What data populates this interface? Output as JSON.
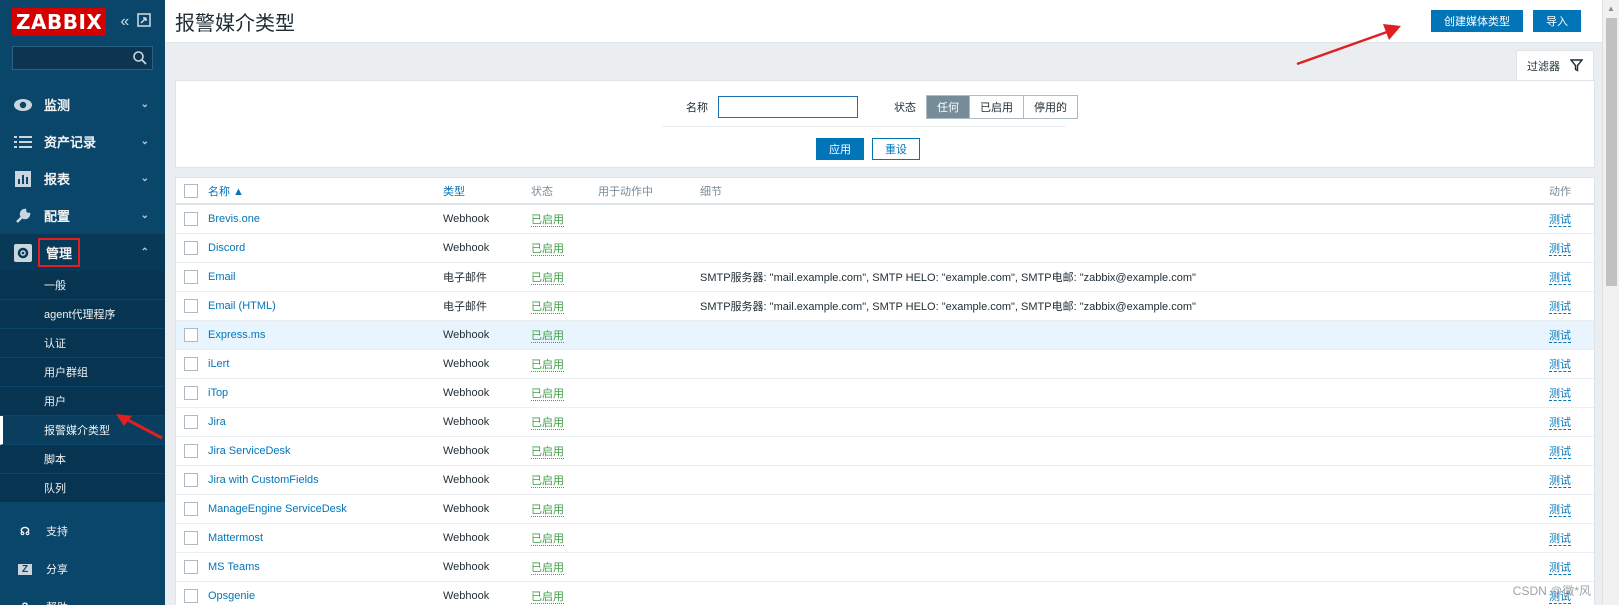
{
  "sidebar": {
    "logo": "ZABBIX",
    "collapse_icon": "double-chevron-left-icon",
    "kiosk_icon": "kiosk-mode-icon",
    "search": {
      "value": "",
      "placeholder": ""
    },
    "menu": [
      {
        "label": "监测",
        "icon": "eye-icon"
      },
      {
        "label": "资产记录",
        "icon": "list-icon"
      },
      {
        "label": "报表",
        "icon": "bar-chart-icon"
      },
      {
        "label": "配置",
        "icon": "wrench-icon"
      },
      {
        "label": "管理",
        "icon": "gear-icon"
      }
    ],
    "submenu": [
      {
        "label": "一般"
      },
      {
        "label": "agent代理程序"
      },
      {
        "label": "认证"
      },
      {
        "label": "用户群组"
      },
      {
        "label": "用户"
      },
      {
        "label": "报警媒介类型"
      },
      {
        "label": "脚本"
      },
      {
        "label": "队列"
      }
    ],
    "bottom": [
      {
        "label": "支持",
        "icon": "headset-icon"
      },
      {
        "label": "分享",
        "icon": "z-icon"
      },
      {
        "label": "帮助",
        "icon": "question-icon"
      }
    ]
  },
  "header": {
    "title": "报警媒介类型",
    "create_button": "创建媒体类型",
    "import_button": "导入"
  },
  "filter": {
    "tab_label": "过滤器",
    "name_label": "名称",
    "name_value": "",
    "status_label": "状态",
    "status_options": [
      "任何",
      "已启用",
      "停用的"
    ],
    "status_selected": "任何",
    "apply_button": "应用",
    "reset_button": "重设"
  },
  "table": {
    "headers": {
      "name": "名称 ▲",
      "type": "类型",
      "status": "状态",
      "used": "用于动作中",
      "details": "细节",
      "action": "动作"
    },
    "rows": [
      {
        "name": "Brevis.one",
        "type": "Webhook",
        "status": "已启用",
        "used": "",
        "details": "",
        "action": "测试"
      },
      {
        "name": "Discord",
        "type": "Webhook",
        "status": "已启用",
        "used": "",
        "details": "",
        "action": "测试"
      },
      {
        "name": "Email",
        "type": "电子邮件",
        "status": "已启用",
        "used": "",
        "details": "SMTP服务器: \"mail.example.com\", SMTP HELO: \"example.com\", SMTP电邮: \"zabbix@example.com\"",
        "action": "测试"
      },
      {
        "name": "Email (HTML)",
        "type": "电子邮件",
        "status": "已启用",
        "used": "",
        "details": "SMTP服务器: \"mail.example.com\", SMTP HELO: \"example.com\", SMTP电邮: \"zabbix@example.com\"",
        "action": "测试"
      },
      {
        "name": "Express.ms",
        "type": "Webhook",
        "status": "已启用",
        "used": "",
        "details": "",
        "action": "测试"
      },
      {
        "name": "iLert",
        "type": "Webhook",
        "status": "已启用",
        "used": "",
        "details": "",
        "action": "测试"
      },
      {
        "name": "iTop",
        "type": "Webhook",
        "status": "已启用",
        "used": "",
        "details": "",
        "action": "测试"
      },
      {
        "name": "Jira",
        "type": "Webhook",
        "status": "已启用",
        "used": "",
        "details": "",
        "action": "测试"
      },
      {
        "name": "Jira ServiceDesk",
        "type": "Webhook",
        "status": "已启用",
        "used": "",
        "details": "",
        "action": "测试"
      },
      {
        "name": "Jira with CustomFields",
        "type": "Webhook",
        "status": "已启用",
        "used": "",
        "details": "",
        "action": "测试"
      },
      {
        "name": "ManageEngine ServiceDesk",
        "type": "Webhook",
        "status": "已启用",
        "used": "",
        "details": "",
        "action": "测试"
      },
      {
        "name": "Mattermost",
        "type": "Webhook",
        "status": "已启用",
        "used": "",
        "details": "",
        "action": "测试"
      },
      {
        "name": "MS Teams",
        "type": "Webhook",
        "status": "已启用",
        "used": "",
        "details": "",
        "action": "测试"
      },
      {
        "name": "Opsgenie",
        "type": "Webhook",
        "status": "已启用",
        "used": "",
        "details": "",
        "action": "测试"
      }
    ]
  },
  "watermark": "CSDN @微*风",
  "colors": {
    "sidebar": "#0a466a",
    "accent": "#0275b8",
    "enabled": "#429e47",
    "annotation": "#e02020"
  }
}
